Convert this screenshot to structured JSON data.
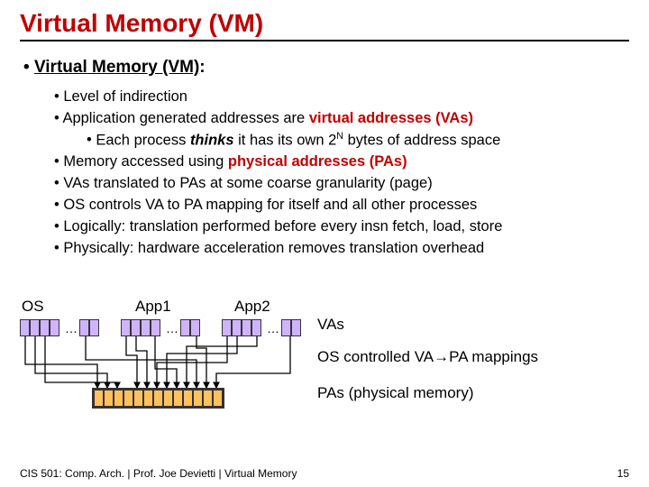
{
  "title": "Virtual Memory (VM)",
  "header_bullet_pre": "Virtual Memory (VM)",
  "header_bullet_post": ":",
  "bullets": {
    "b0": "Level of indirection",
    "b1_pre": "Application generated addresses are ",
    "b1_red": "virtual addresses (VAs)",
    "b1a_pre": "Each process ",
    "b1a_bi": "thinks",
    "b1a_mid": " it has its own 2",
    "b1a_sup": "N",
    "b1a_post": " bytes of address space",
    "b2_pre": "Memory accessed using ",
    "b2_red": "physical addresses (PAs)",
    "b3": "VAs translated to PAs at some coarse granularity (page)",
    "b4": "OS controls VA to PA mapping for itself and all other processes",
    "b5": "Logically: translation performed before every insn fetch, load, store",
    "b6": "Physically: hardware acceleration removes translation overhead"
  },
  "diagram": {
    "os": "OS",
    "app1": "App1",
    "app2": "App2",
    "vas": "VAs",
    "map": "OS controlled VA→PA mappings",
    "pas": "PAs (physical memory)",
    "ell": "…"
  },
  "footer_left": "CIS 501: Comp. Arch.  |  Prof. Joe Devietti  |  Virtual Memory",
  "footer_right": "15"
}
